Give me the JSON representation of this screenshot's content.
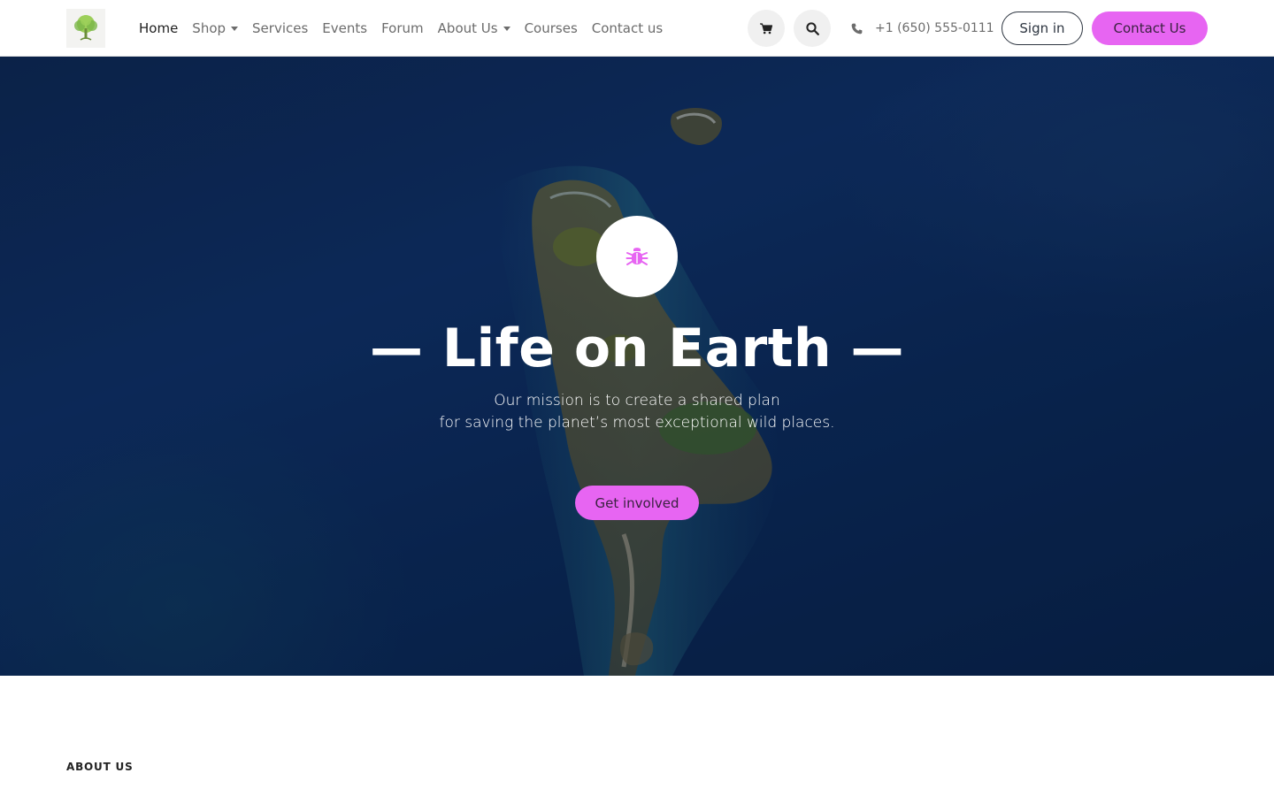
{
  "navbar": {
    "logo": {
      "icon": "tree-logo-icon"
    },
    "menu": [
      {
        "label": "Home",
        "active": true,
        "dropdown": false
      },
      {
        "label": "Shop",
        "active": false,
        "dropdown": true
      },
      {
        "label": "Services",
        "active": false,
        "dropdown": false
      },
      {
        "label": "Events",
        "active": false,
        "dropdown": false
      },
      {
        "label": "Forum",
        "active": false,
        "dropdown": false
      },
      {
        "label": "About Us",
        "active": false,
        "dropdown": true
      },
      {
        "label": "Courses",
        "active": false,
        "dropdown": false
      },
      {
        "label": "Contact us",
        "active": false,
        "dropdown": false
      }
    ],
    "cart_icon": "shopping-cart-icon",
    "search_icon": "search-icon",
    "phone": {
      "icon": "phone-icon",
      "number": "+1 (650) 555-0111"
    },
    "signin_label": "Sign in",
    "contact_label": "Contact Us"
  },
  "hero": {
    "icon": "bug-icon",
    "title": "— Life on Earth —",
    "subtitle_line1": "Our mission is to create a shared plan",
    "subtitle_line2": "for saving the planet’s most exceptional wild places.",
    "cta_label": "Get involved"
  },
  "about": {
    "heading": "ABOUT US"
  },
  "colors": {
    "accent": "#e765f2",
    "hero_overlay": "#0f2a55",
    "text_muted": "#6c6c6c"
  }
}
